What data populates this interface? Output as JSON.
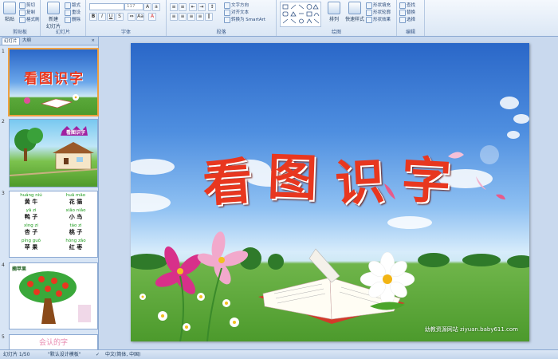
{
  "ribbon": {
    "clipboard": {
      "paste": "粘贴",
      "cut": "剪切",
      "copy": "复制",
      "format_painter": "格式刷",
      "label": "剪贴板"
    },
    "slides": {
      "new_slide": "新建\n幻灯片",
      "layout": "版式",
      "reset": "重设",
      "delete": "删除",
      "label": "幻灯片"
    },
    "font": {
      "size": "117",
      "label": "字体"
    },
    "paragraph": {
      "text_direction": "文字方向",
      "align_text": "对齐文本",
      "smartart": "转换为 SmartArt",
      "label": "段落"
    },
    "drawing": {
      "arrange": "排列",
      "quick_styles": "快速样式",
      "shape_fill": "形状填充",
      "shape_outline": "形状轮廓",
      "shape_effects": "形状效果",
      "label": "绘图"
    },
    "editing": {
      "find": "查找",
      "replace": "替换",
      "select": "选择",
      "label": "编辑"
    }
  },
  "panel": {
    "tabs": [
      "幻灯片",
      "大纲"
    ],
    "close": "×",
    "slide_numbers": [
      "1",
      "2",
      "3",
      "4",
      "5"
    ],
    "thumb1_title": "看图识字",
    "thumb2_title": "看图识字",
    "thumb3_pairs": [
      {
        "py1": "huáng niú",
        "hz1": "黄 牛",
        "py2": "huā māo",
        "hz2": "花 猫"
      },
      {
        "py1": "yā zi",
        "hz1": "鸭 子",
        "py2": "xiǎo niǎo",
        "hz2": "小 鸟"
      },
      {
        "py1": "xìng zi",
        "hz1": "杏 子",
        "py2": "táo zi",
        "hz2": "桃 子"
      },
      {
        "py1": "píng guǒ",
        "hz1": "苹 果",
        "py2": "hóng zǎo",
        "hz2": "红 枣"
      }
    ],
    "thumb4_label": "摘苹果",
    "thumb5_text": "会认的字"
  },
  "slide": {
    "title_chars": [
      "看",
      "图",
      "识",
      "字"
    ],
    "watermark": "幼教资源网站  ziyuan.baby611.com"
  },
  "status": {
    "slide_counter": "幻灯片 1/50",
    "theme": "\"默认设计模板\"",
    "language": "中文(简体, 中国)"
  },
  "colors": {
    "title_red": "#e8371f",
    "ribbon_bg": "#dbe7f5",
    "selected_border": "#f0a040"
  }
}
